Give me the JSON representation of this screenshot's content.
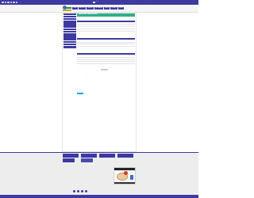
{
  "top_bar": {
    "center_text": "•• •",
    "right_text": "...",
    "right_text2": "..."
  },
  "header": {
    "nav": [
      "HOME",
      "ABOUT US",
      "GALLERY",
      "PROGRAMME",
      "NEWS",
      "CONTACT",
      "LOGIN"
    ]
  },
  "sidebar": {
    "items": [
      "",
      "",
      "",
      "",
      "",
      "",
      "",
      "",
      "",
      "",
      "",
      "",
      "",
      ""
    ]
  },
  "main": {
    "title": "MESS DAILY MEAL REPORT",
    "section1_label": "...",
    "section1_sub": "...",
    "table1": {
      "headers": [
        "",
        "",
        "",
        ""
      ],
      "rows": [
        [
          "",
          "",
          "",
          ""
        ],
        [
          "",
          "",
          "",
          ""
        ],
        [
          "",
          "",
          "",
          ""
        ],
        [
          "",
          "",
          "",
          ""
        ]
      ]
    },
    "section2_label": "...",
    "table2": {
      "headers": [
        "",
        "",
        "",
        ""
      ],
      "rows": [
        [
          "",
          "",
          "",
          ""
        ],
        [
          "",
          "",
          "",
          ""
        ],
        [
          "",
          "",
          "",
          ""
        ]
      ]
    },
    "section3_label": "...",
    "table3": {
      "headers": [
        "",
        "",
        ""
      ],
      "rows": [
        [
          "",
          "",
          ""
        ],
        [
          "",
          "",
          ""
        ],
        [
          "",
          "",
          ""
        ],
        [
          "",
          "",
          ""
        ]
      ]
    },
    "form_label1": "...",
    "form_label2": "...",
    "info_lines": [
      "...",
      "...",
      "...",
      "...",
      "...",
      "..."
    ],
    "submit_label": "SUBMIT"
  },
  "footer": {
    "badges": [
      "",
      "",
      "",
      "",
      ""
    ],
    "links": [
      "",
      "",
      "",
      "",
      "",
      ""
    ],
    "contact": [
      "",
      "",
      "",
      "",
      ""
    ],
    "copyright": "..."
  },
  "colors": {
    "primary": "#3d3aa0",
    "accent": "#2fae8a",
    "button": "#27a3d4",
    "footer_bg": "#ededed"
  }
}
